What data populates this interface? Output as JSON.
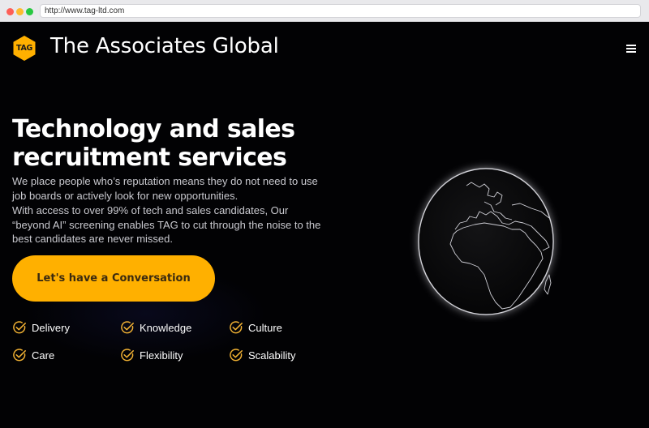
{
  "browser": {
    "url": "http://www.tag-ltd.com"
  },
  "header": {
    "logo_text": "TAG",
    "brand_name": "The Associates Global",
    "menu_icon": "hamburger-menu-icon"
  },
  "hero": {
    "headline_line1": "Technology and sales",
    "headline_line2": "recruitment services",
    "paragraph1": "We place people who’s reputation means they do not need to use job boards or actively look for new opportunities.",
    "paragraph2": "With access to over 99% of tech and sales candidates, Our “beyond AI” screening enables TAG to cut through the noise to the best candidates are never missed.",
    "cta_label": "Let's have a Conversation"
  },
  "features": [
    {
      "label": "Delivery"
    },
    {
      "label": "Knowledge"
    },
    {
      "label": "Culture"
    },
    {
      "label": "Care"
    },
    {
      "label": "Flexibility"
    },
    {
      "label": "Scalability"
    }
  ],
  "colors": {
    "accent": "#ffb000",
    "background": "#020204",
    "text": "#ffffff",
    "check": "#f2b233"
  },
  "icons": {
    "feature_check": "check-circle-icon",
    "globe": "globe-icon"
  }
}
